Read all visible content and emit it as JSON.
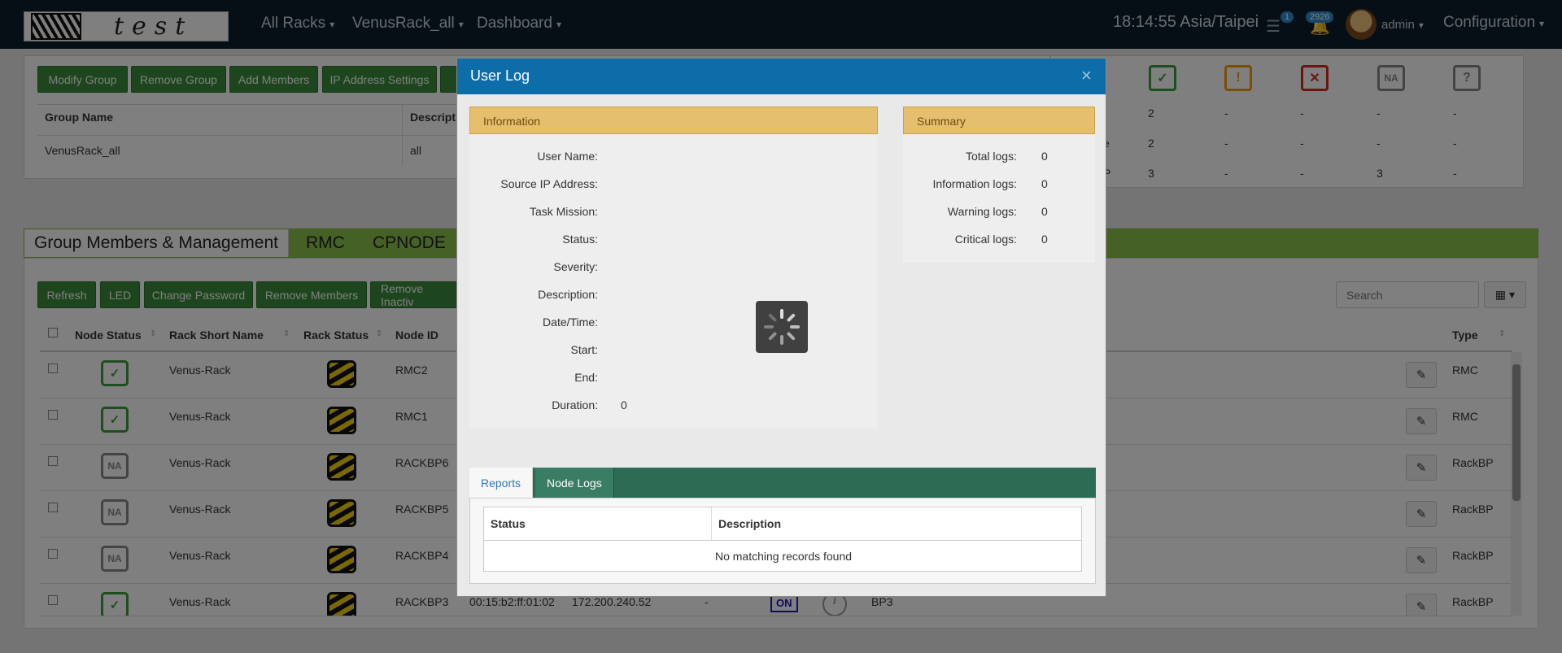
{
  "navbar": {
    "logo_text": "test",
    "menu": [
      {
        "label": "All Racks"
      },
      {
        "label": "VenusRack_all"
      },
      {
        "label": "Dashboard"
      }
    ],
    "clock": "18:14:55 Asia/Taipei",
    "messages_badge": "1",
    "alerts_badge": "2926",
    "user": "admin",
    "configuration": "Configuration"
  },
  "group_toolbar": {
    "modify": "Modify Group",
    "remove": "Remove Group",
    "add_members": "Add Members",
    "ip_settings": "IP Address Settings"
  },
  "group_table": {
    "headers": [
      "Group Name",
      "Descripti"
    ],
    "row": {
      "name": "VenusRack_all",
      "description": "all"
    }
  },
  "summary_counts": {
    "rows": [
      {
        "label": "",
        "ok": "2",
        "warn": "-",
        "crit": "-",
        "na": "-",
        "unknown": "-"
      },
      {
        "label": "e",
        "ok": "2",
        "warn": "-",
        "crit": "-",
        "na": "-",
        "unknown": "-"
      },
      {
        "label": "P",
        "ok": "3",
        "warn": "-",
        "crit": "-",
        "na": "3",
        "unknown": "-"
      }
    ]
  },
  "tabs": {
    "main": "Group Members & Management",
    "rmc": "RMC",
    "cpnode": "CPNODE"
  },
  "member_toolbar": {
    "refresh": "Refresh",
    "led": "LED",
    "change_password": "Change Password",
    "remove_members": "Remove Members",
    "remove_inactive": "Remove Inactiv"
  },
  "search": {
    "placeholder": "Search"
  },
  "members_table": {
    "headers": [
      "Node Status",
      "Rack Short Name",
      "Rack Status",
      "Node ID",
      "Type"
    ],
    "rows": [
      {
        "status": "ok",
        "rack": "Venus-Rack",
        "node_id": "RMC2",
        "type": "RMC"
      },
      {
        "status": "ok",
        "rack": "Venus-Rack",
        "node_id": "RMC1",
        "type": "RMC"
      },
      {
        "status": "na",
        "rack": "Venus-Rack",
        "node_id": "RACKBP6",
        "type": "RackBP"
      },
      {
        "status": "na",
        "rack": "Venus-Rack",
        "node_id": "RACKBP5",
        "type": "RackBP"
      },
      {
        "status": "na",
        "rack": "Venus-Rack",
        "node_id": "RACKBP4",
        "type": "RackBP"
      },
      {
        "status": "ok",
        "rack": "Venus-Rack",
        "node_id": "RACKBP3",
        "type": "RackBP",
        "mac": "00:15:b2:ff:01:02",
        "ip": "172.200.240.52",
        "extra": "-",
        "led": "ON",
        "name": "BP3"
      }
    ]
  },
  "modal": {
    "title": "User Log",
    "information": {
      "heading": "Information",
      "fields": [
        {
          "label": "User Name:",
          "value": ""
        },
        {
          "label": "Source IP Address:",
          "value": ""
        },
        {
          "label": "Task Mission:",
          "value": ""
        },
        {
          "label": "Status:",
          "value": ""
        },
        {
          "label": "Severity:",
          "value": ""
        },
        {
          "label": "Description:",
          "value": ""
        },
        {
          "label": "Date/Time:",
          "value": ""
        },
        {
          "label": "Start:",
          "value": ""
        },
        {
          "label": "End:",
          "value": ""
        },
        {
          "label": "Duration:",
          "value": "0"
        }
      ]
    },
    "summary": {
      "heading": "Summary",
      "fields": [
        {
          "label": "Total logs:",
          "value": "0"
        },
        {
          "label": "Information logs:",
          "value": "0"
        },
        {
          "label": "Warning logs:",
          "value": "0"
        },
        {
          "label": "Critical logs:",
          "value": "0"
        }
      ]
    },
    "tabs": {
      "reports": "Reports",
      "node_logs": "Node Logs"
    },
    "reports_table": {
      "headers": [
        "Status",
        "Description"
      ],
      "empty": "No matching records found"
    }
  },
  "colors": {
    "navbar": "#0c1f2c",
    "modal_header": "#0d6da8",
    "box_header": "#e6bf6e",
    "green_button": "#3c8c3c",
    "tab_bar": "#8bc34a",
    "report_tabs": "#2e6b55"
  }
}
